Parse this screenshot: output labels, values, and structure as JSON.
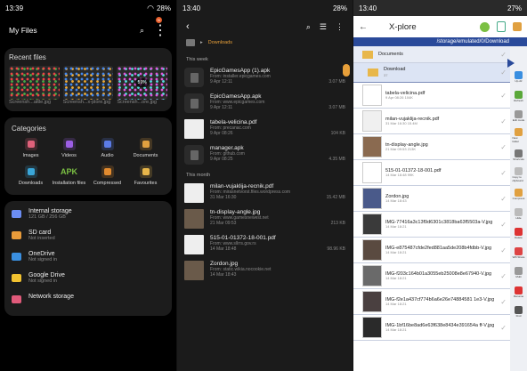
{
  "p1": {
    "time": "13:39",
    "battery": "28%",
    "title": "My Files",
    "badge": "N",
    "recent": {
      "label": "Recent files",
      "items": [
        {
          "name": "Screensh...attle.jpg"
        },
        {
          "name": "Screensh...x-plore.jpg"
        },
        {
          "name": "Screensh...ore.jpg"
        }
      ],
      "overlay": "59%"
    },
    "categories": {
      "label": "Categories",
      "items": [
        {
          "label": "Images",
          "icon": "image-icon",
          "color": "#e0617a"
        },
        {
          "label": "Videos",
          "icon": "video-icon",
          "color": "#9c5ee6"
        },
        {
          "label": "Audio",
          "icon": "music-note-icon",
          "color": "#5b7be6"
        },
        {
          "label": "Documents",
          "icon": "document-icon",
          "color": "#e0a040"
        },
        {
          "label": "Downloads",
          "icon": "download-icon",
          "color": "#3aa6d8"
        },
        {
          "label": "Installation files",
          "icon": "apk-icon",
          "glyph": "APK",
          "color": "#7bc043"
        },
        {
          "label": "Compressed",
          "icon": "zip-icon",
          "color": "#e28b2f"
        },
        {
          "label": "Favourites",
          "icon": "star-icon",
          "color": "#e8b64a"
        }
      ]
    },
    "storage": [
      {
        "name": "Internal storage",
        "sub": "121 GB / 256 GB",
        "icon": "phone-icon",
        "color": "#6c8df2"
      },
      {
        "name": "SD card",
        "sub": "Not inserted",
        "icon": "sd-card-icon",
        "color": "#e89b3a"
      },
      {
        "name": "OneDrive",
        "sub": "Not signed in",
        "icon": "cloud-icon",
        "color": "#3a8fe0"
      },
      {
        "name": "Google Drive",
        "sub": "Not signed in",
        "icon": "google-drive-icon",
        "color": "#f2c230"
      },
      {
        "name": "Network storage",
        "sub": "",
        "icon": "server-icon",
        "color": "#e05a7a"
      }
    ]
  },
  "p2": {
    "time": "13:40",
    "battery": "28%",
    "badge": "N",
    "path": "Downloads",
    "week": "This week",
    "month": "This month",
    "files_week": [
      {
        "name": "EpicGamesApp (1).apk",
        "from": "From: installer.epicgames.com",
        "date": "9 Apr 12:11",
        "size": "3.07 MB",
        "icon": "apk-file-icon"
      },
      {
        "name": "EpicGamesApp.apk",
        "from": "From: www.epicgames.com",
        "date": "9 Apr 12:11",
        "size": "3.07 MB",
        "icon": "apk-file-icon"
      },
      {
        "name": "tabela-velicina.pdf",
        "from": "From: precanac.com",
        "date": "9 Apr 08:26",
        "size": "104 KB",
        "icon": "pdf-thumb-icon"
      },
      {
        "name": "manager.apk",
        "from": "From: github.com",
        "date": "9 Apr 08:25",
        "size": "4.35 MB",
        "icon": "apk-file-icon"
      }
    ],
    "files_month": [
      {
        "name": "milan-vujaklija-recnik.pdf",
        "from": "From: mirasnetvorst.files.wordpress.com",
        "date": "31 Mar 16:30",
        "size": "15.42 MB",
        "icon": "pdf-thumb-icon"
      },
      {
        "name": "tn-display-angle.jpg",
        "from": "From: www.gamesnewest.net",
        "date": "21 Mar 09:53",
        "size": "213 KB",
        "icon": "image-thumb-icon"
      },
      {
        "name": "515-01-01372-18-001.pdf",
        "from": "From: www.sllrrs.gov.rs",
        "date": "14 Mar 18:48",
        "size": "98.96 KB",
        "icon": "pdf-thumb-icon"
      },
      {
        "name": "Zordon.jpg",
        "from": "From: static.wikia.nocookie.net",
        "date": "14 Mar 18:43",
        "size": "",
        "icon": "image-thumb-icon"
      }
    ]
  },
  "p3": {
    "time": "13:40",
    "battery": "27%",
    "title": "X-plore",
    "path": "/storage/emulated/0/Download",
    "folders": [
      {
        "name": "Documents"
      },
      {
        "name": "Download",
        "sub": "37"
      }
    ],
    "files": [
      {
        "name": "tabela-velicina.pdf",
        "date": "9 Apr 08:26",
        "size": "104K",
        "thumb": "#ffffff"
      },
      {
        "name": "milan-vujaklija-recnik.pdf",
        "date": "31 Mar 16:30",
        "size": "15.4M",
        "thumb": "#f0f0f0"
      },
      {
        "name": "tn-display-angle.jpg",
        "date": "21 Mar 09:53",
        "size": "213K",
        "thumb": "#8a6a50"
      },
      {
        "name": "515-01-01372-18-001.pdf",
        "date": "14 Mar 18:48",
        "size": "99K",
        "thumb": "#ffffff"
      },
      {
        "name": "Zordon.jpg",
        "date": "14 Mar 18:43",
        "size": "",
        "thumb": "#4a5a8a"
      },
      {
        "name": "IMG-77416a3c13f9d6301c3818ba63f5503a-V.jpg",
        "date": "14 Mar 18:21",
        "size": "",
        "thumb": "#3a3a3a"
      },
      {
        "name": "IMG-e875487cfde2fed881aa5de208b4fdbb-V.jpg",
        "date": "14 Mar 18:21",
        "size": "",
        "thumb": "#5a4a40"
      },
      {
        "name": "IMG-f203c164b01a3055eb25008e8e67940-V.jpg",
        "date": "14 Mar 18:21",
        "size": "",
        "thumb": "#6a6a6a"
      },
      {
        "name": "IMG-f2e1a437cf774b6a6e26e74884581 1e3-V.jpg",
        "date": "14 Mar 18:21",
        "size": "",
        "thumb": "#4a4040"
      },
      {
        "name": "IMG-1bf16be8ad6e63f638e8434e391654a ff-V.jpg",
        "date": "14 Mar 18:21",
        "size": "",
        "thumb": "#2a2a2a"
      }
    ],
    "tools": [
      {
        "label": "Up-dir",
        "color": "#3a8fe0"
      },
      {
        "label": "Refresh",
        "color": "#5aa83a"
      },
      {
        "label": "Edit mode",
        "color": "#999"
      },
      {
        "label": "New folder",
        "color": "#e0a040"
      },
      {
        "label": "Shortcuts",
        "color": "#777"
      },
      {
        "label": "Copy to clipboard",
        "color": "#bbb"
      },
      {
        "label": "Compress",
        "color": "#e0a040"
      },
      {
        "label": "Hide",
        "color": "#bbb"
      },
      {
        "label": "Delete",
        "color": "#d33"
      },
      {
        "label": "Wifi Share",
        "color": "#d44"
      },
      {
        "label": "Multi",
        "color": "#999"
      },
      {
        "label": "Rename",
        "color": "#d33"
      },
      {
        "label": "Find",
        "color": "#555"
      }
    ]
  }
}
